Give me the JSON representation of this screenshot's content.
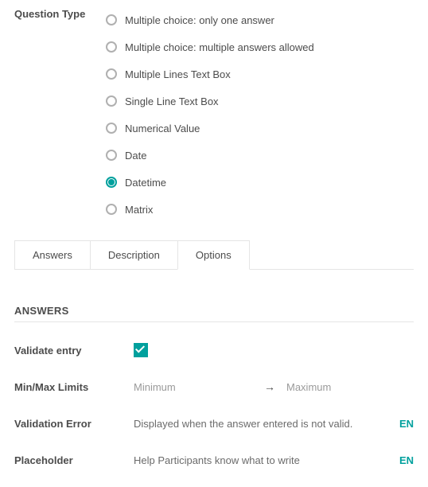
{
  "questionType": {
    "label": "Question Type",
    "options": [
      "Multiple choice: only one answer",
      "Multiple choice: multiple answers allowed",
      "Multiple Lines Text Box",
      "Single Line Text Box",
      "Numerical Value",
      "Date",
      "Datetime",
      "Matrix"
    ],
    "selectedIndex": 6
  },
  "tabs": {
    "items": [
      "Answers",
      "Description",
      "Options"
    ],
    "activeIndex": 2
  },
  "section": {
    "title": "ANSWERS"
  },
  "fields": {
    "validateEntry": {
      "label": "Validate entry",
      "checked": true
    },
    "minmax": {
      "label": "Min/Max Limits",
      "minPlaceholder": "Minimum",
      "maxPlaceholder": "Maximum",
      "arrow": "→"
    },
    "validationError": {
      "label": "Validation Error",
      "text": "Displayed when the answer entered is not valid.",
      "langCode": "EN"
    },
    "placeholder": {
      "label": "Placeholder",
      "text": "Help Participants know what to write",
      "langCode": "EN"
    }
  }
}
